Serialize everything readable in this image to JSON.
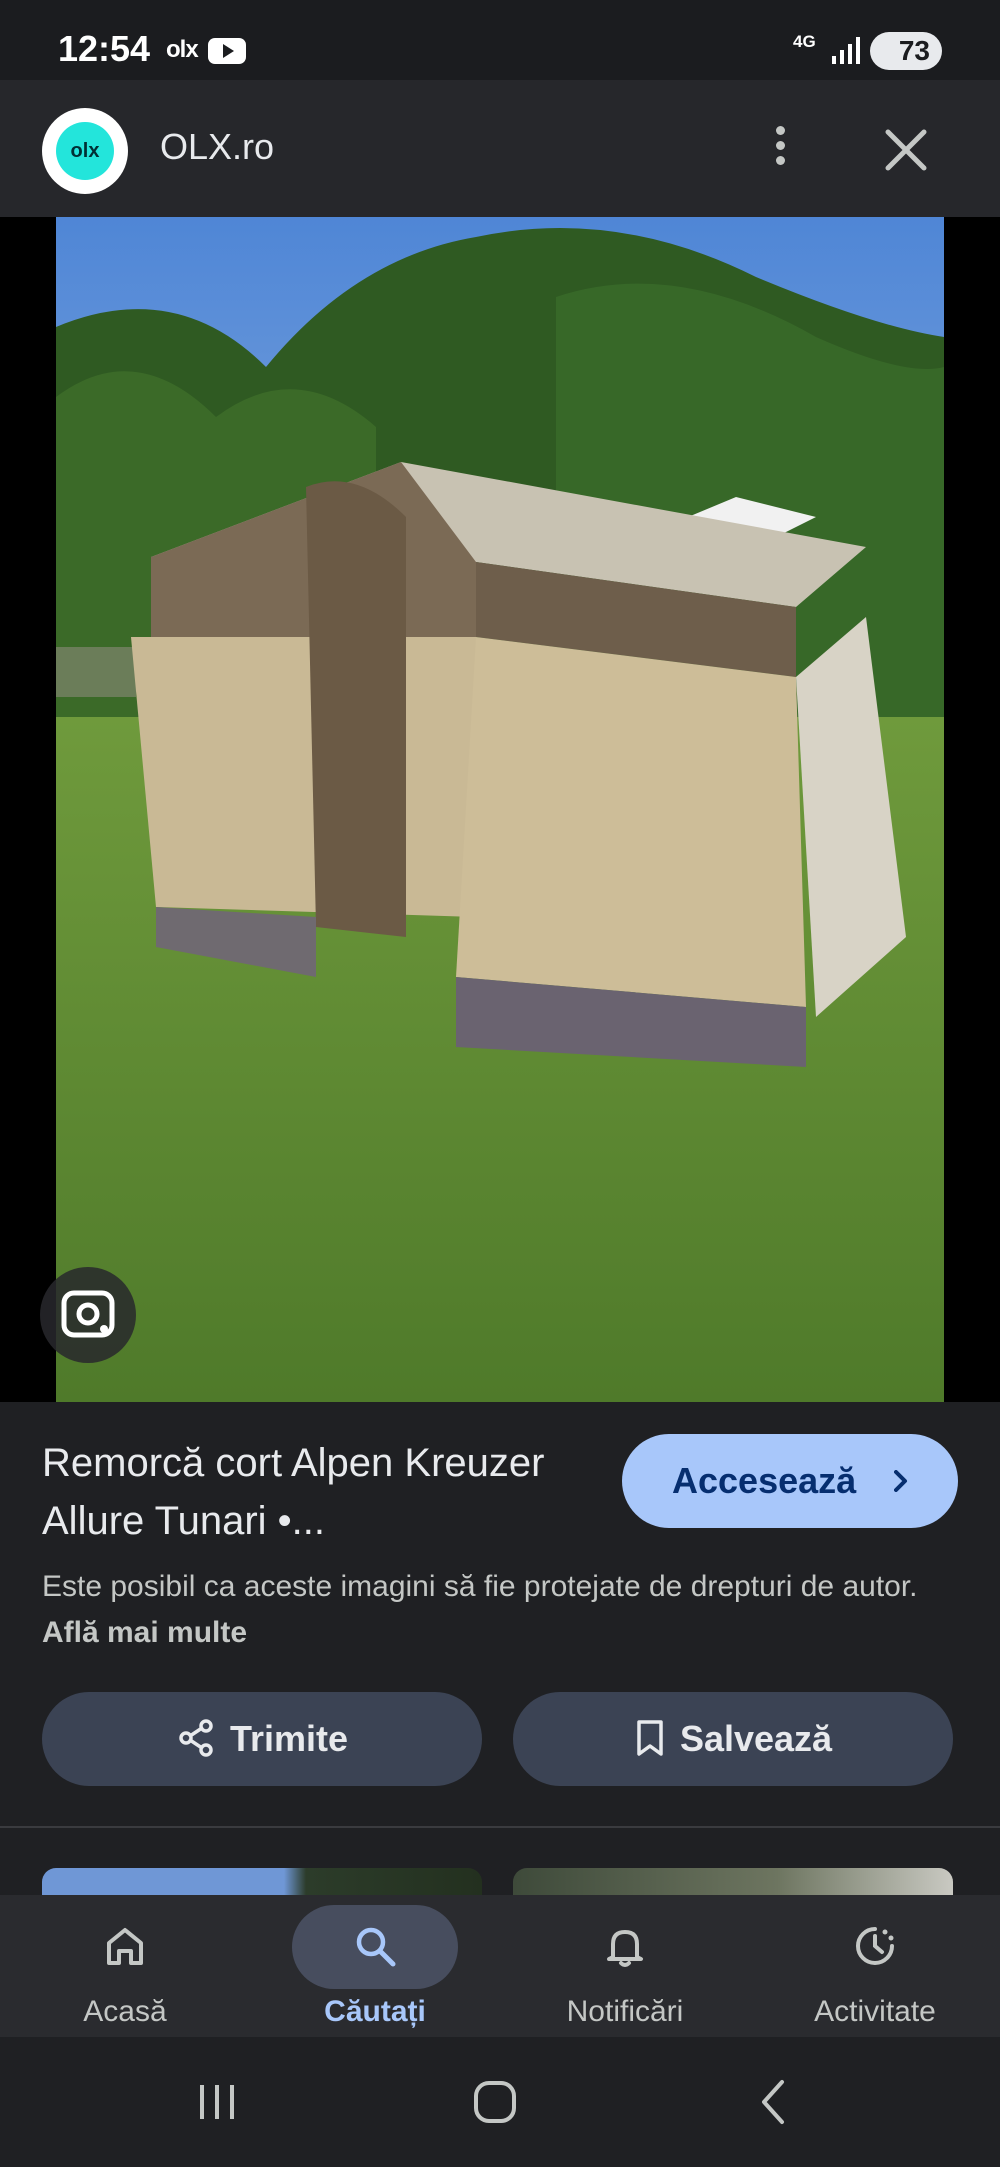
{
  "status_bar": {
    "time": "12:54",
    "notification_olx": "olx",
    "network": "4G",
    "battery": "73"
  },
  "header": {
    "site_name": "OLX.ro",
    "logo_text": "olx",
    "more_icon": "more-vert-icon",
    "close_icon": "close-icon"
  },
  "image": {
    "description_icon": "lens-icon"
  },
  "result": {
    "title": "Remorcă cort Alpen Kreuzer Allure Tunari •...",
    "visit_label": "Accesează",
    "copyright_text": "Este posibil ca aceste imagini să fie protejate de drepturi de autor.",
    "learn_more": "Află mai multe",
    "share_label": "Trimite",
    "save_label": "Salvează"
  },
  "bottom_nav": {
    "items": [
      {
        "label": "Acasă",
        "icon": "home-icon",
        "active": false
      },
      {
        "label": "Căutați",
        "icon": "search-icon",
        "active": true
      },
      {
        "label": "Notificări",
        "icon": "bell-icon",
        "active": false
      },
      {
        "label": "Activitate",
        "icon": "history-icon",
        "active": false
      }
    ]
  },
  "colors": {
    "accent": "#a8c7fa",
    "background": "#1f2023",
    "button": "#3b4354"
  }
}
